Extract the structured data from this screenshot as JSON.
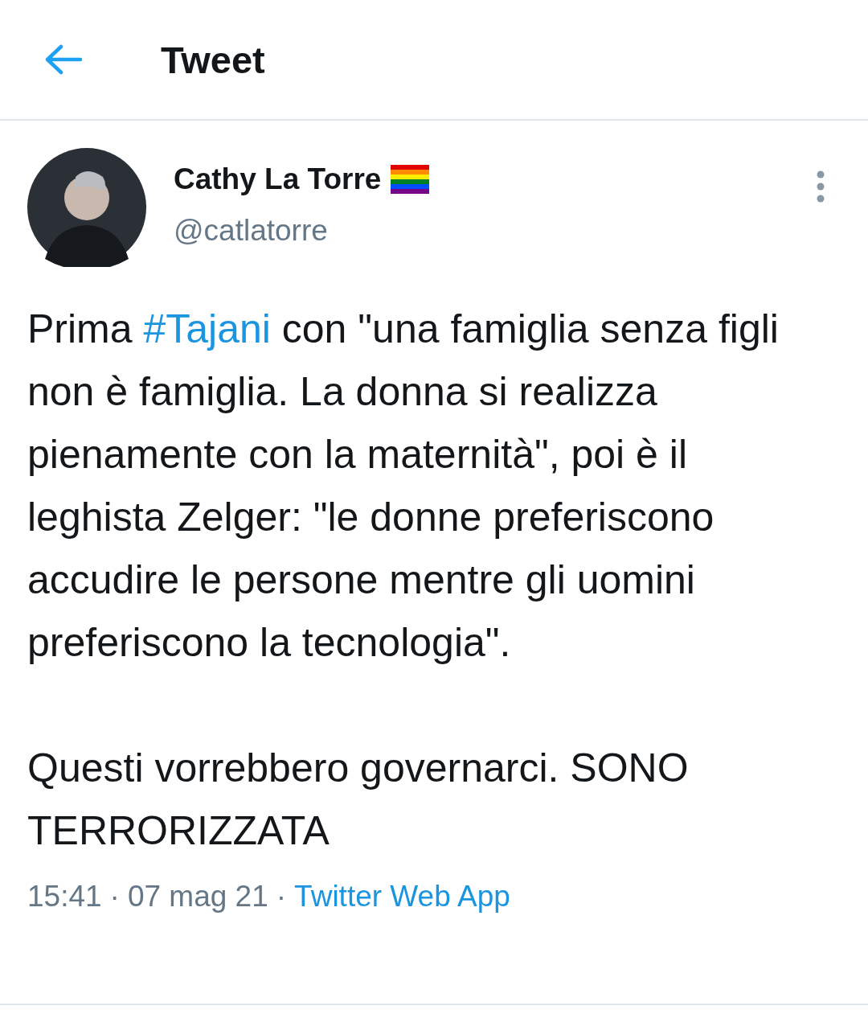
{
  "header": {
    "title": "Tweet"
  },
  "tweet": {
    "author": {
      "name": "Cathy La Torre",
      "handle": "@catlatorre"
    },
    "paragraphs": [
      [
        {
          "kind": "text",
          "text": "Prima "
        },
        {
          "kind": "hashtag",
          "text": "#Tajani"
        },
        {
          "kind": "text",
          "text": " con \"una famiglia senza figli non è famiglia. La donna si realizza pienamente con la maternità\", poi è il leghista Zelger: \"le donne preferiscono accudire le persone mentre gli uomini preferiscono la tecnologia\"."
        }
      ],
      [
        {
          "kind": "text",
          "text": "Questi vorrebbero governarci. SONO TERRORIZZATA"
        }
      ]
    ],
    "meta": {
      "time": "15:41",
      "separator": "·",
      "date": "07 mag 21",
      "source": "Twitter Web App"
    }
  }
}
